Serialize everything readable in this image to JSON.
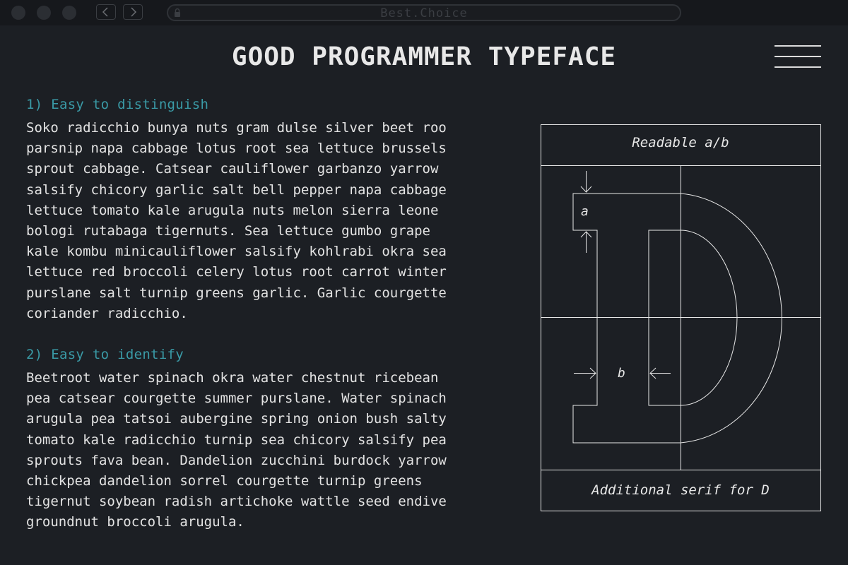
{
  "browser": {
    "url": "Best.Choice",
    "back_icon": "chevron-left-icon",
    "forward_icon": "chevron-right-icon",
    "lock_icon": "lock-icon"
  },
  "header": {
    "title": "GOOD PROGRAMMER TYPEFACE",
    "menu_icon": "hamburger-menu-icon"
  },
  "sections": [
    {
      "heading": "1) Easy to distinguish",
      "lines": [
        "Soko radicchio bunya nuts gram dulse silver beet roo",
        "parsnip napa cabbage lotus root sea lettuce brussels",
        "sprout cabbage. Catsear cauliflower garbanzo yarrow",
        "salsify chicory garlic salt bell pepper napa cabbage",
        "lettuce tomato kale arugula nuts melon sierra leone",
        "bologi rutabaga tigernuts. Sea lettuce gumbo grape",
        "kale kombu minicauliflower salsify kohlrabi okra sea",
        "lettuce red broccoli celery lotus root carrot winter",
        "purslane salt turnip greens garlic. Garlic courgette",
        "coriander radicchio."
      ]
    },
    {
      "heading": "2) Easy to identify",
      "lines": [
        "Beetroot water spinach okra water chestnut ricebean",
        "pea catsear courgette summer purslane. Water spinach",
        "arugula pea tatsoi aubergine spring onion bush salty",
        "tomato kale radicchio turnip sea chicory salsify pea",
        "sprouts fava bean. Dandelion zucchini burdock yarrow",
        "chickpea dandelion sorrel courgette turnip greens",
        "tigernut soybean radish artichoke wattle seed endive",
        "groundnut broccoli arugula."
      ]
    }
  ],
  "diagram": {
    "top_label": "Readable a/b",
    "bottom_label": "Additional serif for D",
    "label_a": "a",
    "label_b": "b",
    "glyph": "D",
    "line_color": "#e8e8e8"
  },
  "colors": {
    "background": "#1c1f24",
    "heading_accent": "#3a9aa6",
    "text": "#e3e3e3"
  }
}
